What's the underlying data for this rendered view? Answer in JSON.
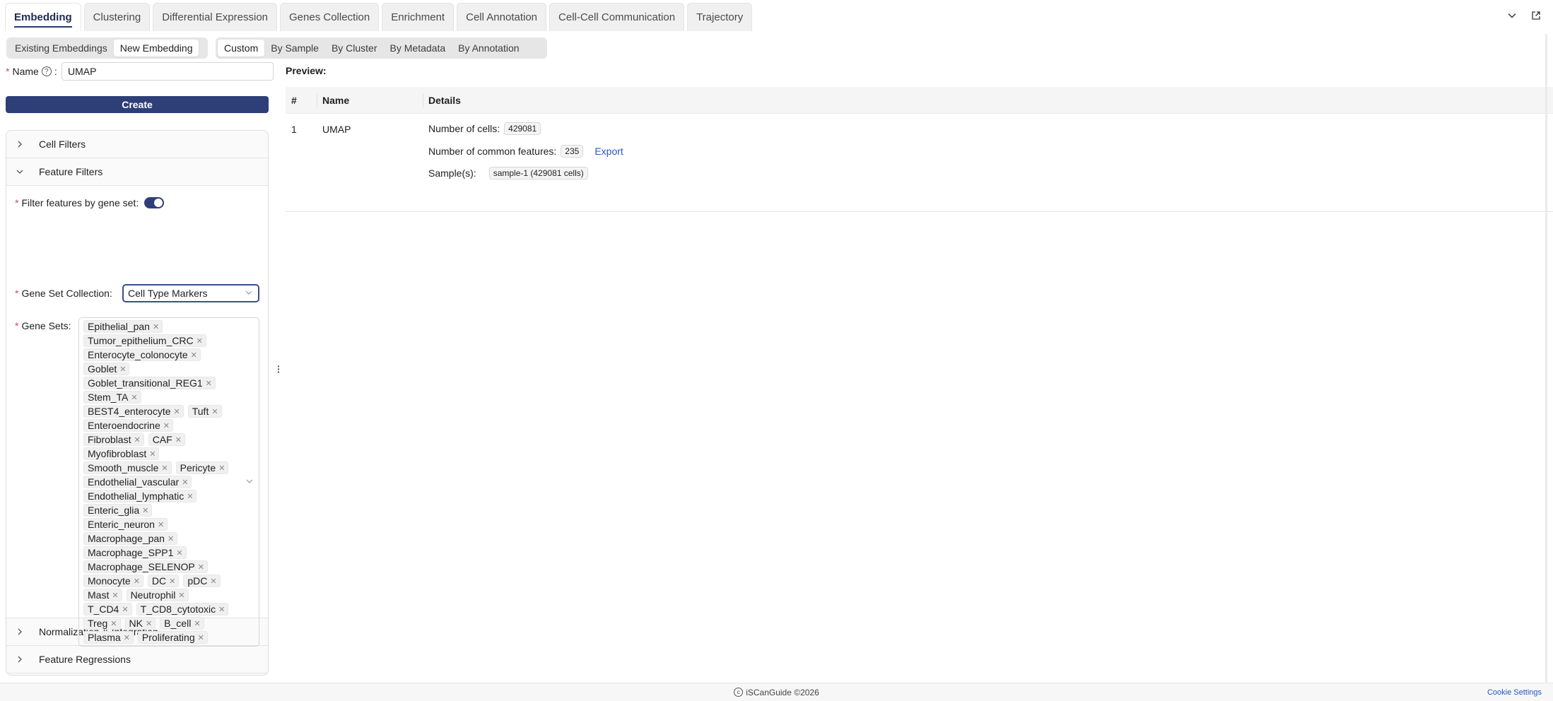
{
  "top_tabs": [
    "Embedding",
    "Clustering",
    "Differential Expression",
    "Genes Collection",
    "Enrichment",
    "Cell Annotation",
    "Cell-Cell Communication",
    "Trajectory"
  ],
  "embedding_mode": [
    "Existing Embeddings",
    "New Embedding"
  ],
  "embedding_source": [
    "Custom",
    "By Sample",
    "By Cluster",
    "By Metadata",
    "By Annotation"
  ],
  "form": {
    "name_label": "Name",
    "name_value": "UMAP",
    "create_label": "Create"
  },
  "panels": {
    "cell_filters": "Cell Filters",
    "feature_filters": "Feature Filters",
    "normalization": "Normalization & Integration",
    "feature_regressions": "Feature Regressions"
  },
  "feature_filters": {
    "filter_by_gene_set_label": "Filter features by gene set",
    "filter_by_gene_set_on": true,
    "gene_set_collection_label": "Gene Set Collection",
    "gene_set_collection_value": "Cell Type Markers",
    "gene_sets_label": "Gene Sets",
    "gene_set_rows": [
      [
        "Epithelial_pan"
      ],
      [
        "Tumor_epithelium_CRC"
      ],
      [
        "Enterocyte_colonocyte"
      ],
      [
        "Goblet"
      ],
      [
        "Goblet_transitional_REG1"
      ],
      [
        "Stem_TA"
      ],
      [
        "BEST4_enterocyte",
        "Tuft"
      ],
      [
        "Enteroendocrine"
      ],
      [
        "Fibroblast",
        "CAF"
      ],
      [
        "Myofibroblast"
      ],
      [
        "Smooth_muscle",
        "Pericyte"
      ],
      [
        "Endothelial_vascular"
      ],
      [
        "Endothelial_lymphatic"
      ],
      [
        "Enteric_glia"
      ],
      [
        "Enteric_neuron"
      ],
      [
        "Macrophage_pan"
      ],
      [
        "Macrophage_SPP1"
      ],
      [
        "Macrophage_SELENOP"
      ],
      [
        "Monocyte",
        "DC",
        "pDC"
      ],
      [
        "Mast",
        "Neutrophil"
      ],
      [
        "T_CD4",
        "T_CD8_cytotoxic"
      ],
      [
        "Treg",
        "NK",
        "B_cell"
      ],
      [
        "Plasma",
        "Proliferating"
      ]
    ]
  },
  "preview": {
    "title": "Preview:",
    "columns": [
      "#",
      "Name",
      "Details"
    ],
    "row": {
      "index": "1",
      "name": "UMAP",
      "cells_label": "Number of cells:",
      "cells_value": "429081",
      "features_label": "Number of common features:",
      "features_value": "235",
      "export_label": "Export",
      "samples_label": "Sample(s):",
      "samples_value": "sample-1 (429081 cells)"
    }
  },
  "footer": {
    "copyright": "iSCanGuide ©2026",
    "cookie_settings": "Cookie Settings"
  },
  "colors": {
    "primary": "#2e3f78",
    "link": "#2457c5",
    "required": "#e04848"
  }
}
